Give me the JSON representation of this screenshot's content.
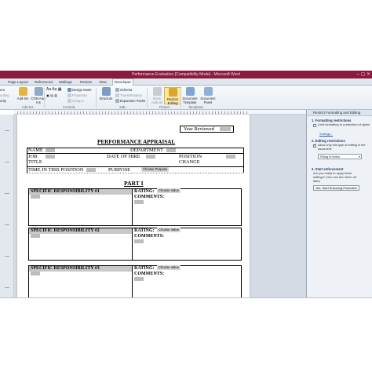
{
  "window": {
    "title": "Performance Evaluation [Compatibility Mode] - Microsoft Word"
  },
  "tabs": [
    {
      "label": "Page Layout"
    },
    {
      "label": "References"
    },
    {
      "label": "Mailings"
    },
    {
      "label": "Review"
    },
    {
      "label": "View"
    },
    {
      "label": "Developer"
    }
  ],
  "ribbon": {
    "left_cut": [
      "ero",
      "ording",
      "urity"
    ],
    "addins_label": "Add-Ins",
    "com_addins_label": "COM Add-Ins",
    "addins_group": "Add-Ins",
    "design_mode": "Design Mode",
    "properties": "Properties",
    "group_btn": "Group",
    "controls_group": "Controls",
    "structure": "Structure",
    "schema": "Schema",
    "transformation": "Transformation",
    "expansion_packs": "Expansion Packs",
    "xml_group": "XML",
    "block_authors": "Block Authors",
    "restrict_editing": "Restrict Editing",
    "protect_group": "Protect",
    "document_template": "Document Template",
    "document_panel": "Document Panel",
    "templates_group": "Templates"
  },
  "document": {
    "year_reviewed": "Year Reviewed",
    "title": "PERFORMANCE APPRAISAL",
    "name": "NAME",
    "department": "DEPARTMENT",
    "job_title_1": "JOB",
    "job_title_2": "TITLE",
    "date_of_hire": "DATE OF HIRE",
    "position_change_1": "POSITION",
    "position_change_2": "CHANGE",
    "time_in_position": "TIME IN THIS POSITION",
    "purpose": "PURPOSE",
    "choose_purpose": "Choose Purpose",
    "part": "PART I",
    "responsibilities": [
      {
        "label": "SPECIFIC RESPONSIBILITY #1",
        "rating": "RATING:",
        "choose": "Choose Value",
        "comments": "COMMENTS:"
      },
      {
        "label": "SPECIFIC RESPONSIBILITY #2",
        "rating": "RATING:",
        "choose": "Choose Value",
        "comments": "COMMENTS:"
      },
      {
        "label": "SPECIFIC RESPONSIBILITY #3",
        "rating": "RATING:",
        "choose": "Choose Value",
        "comments": "COMMENTS:"
      }
    ]
  },
  "pane": {
    "title": "Restrict Formatting and Editing",
    "sec1": "1. Formatting restrictions",
    "sec1_text": "Limit formatting to a selection of styles",
    "settings": "Settings...",
    "sec2": "2. Editing restrictions",
    "sec2_text": "Allow only this type of editing in the document:",
    "sec2_select": "Filling in forms",
    "sec3": "3. Start enforcement",
    "sec3_text": "Are you ready to apply these settings? (You can turn them off later)",
    "enforce_btn": "Yes, Start Enforcing Protection"
  }
}
